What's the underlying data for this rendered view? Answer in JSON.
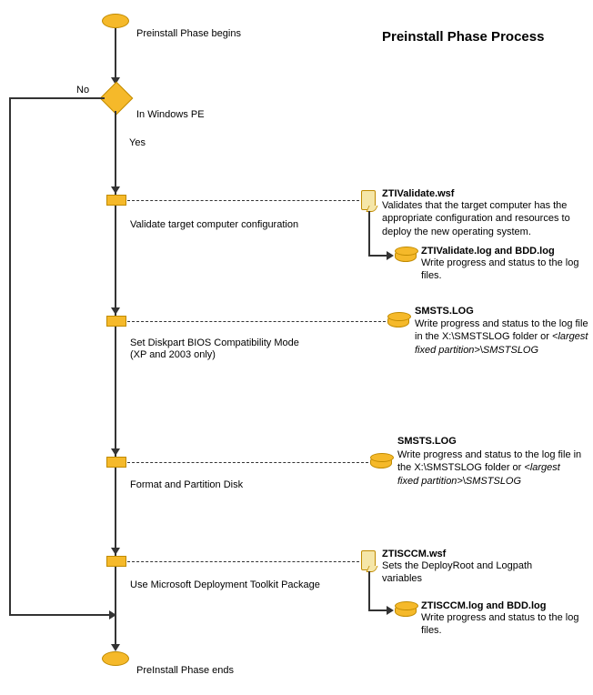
{
  "title": "Preinstall Phase Process",
  "start": "Preinstall Phase begins",
  "decision": {
    "label": "In Windows PE",
    "yes": "Yes",
    "no": "No"
  },
  "steps": [
    {
      "proc_label": "Validate target computer configuration",
      "right": [
        {
          "kind": "scroll",
          "title": "ZTIValidate.wsf",
          "text": "Validates that the target computer has the appropriate configuration and resources to deploy the new operating system."
        },
        {
          "kind": "db",
          "title": "ZTIValidate.log and BDD.log",
          "text": "Write progress and status to the log files."
        }
      ]
    },
    {
      "proc_label": "Set Diskpart BIOS Compatibility Mode",
      "proc_sub": "(XP and 2003 only)",
      "right": [
        {
          "kind": "db",
          "title": "SMSTS.LOG",
          "text_html": "Write progress and status to the log file in the X:\\SMSTSLOG folder or <i>&lt;largest fixed partition&gt;</i>\\<i>SMSTSLOG</i>"
        }
      ]
    },
    {
      "proc_label": "Format and Partition Disk",
      "right": [
        {
          "kind": "db",
          "title": "SMSTS.LOG",
          "text_html": "Write progress and status to the log file in the X:\\SMSTSLOG folder or <i>&lt;largest fixed partition&gt;</i>\\<i>SMSTSLOG</i>"
        }
      ]
    },
    {
      "proc_label": "Use Microsoft Deployment Toolkit Package",
      "right": [
        {
          "kind": "scroll",
          "title": "ZTISCCM.wsf",
          "text": "Sets the DeployRoot and Logpath variables"
        },
        {
          "kind": "db",
          "title": "ZTISCCM.log and BDD.log",
          "text": "Write progress and status to the log files."
        }
      ]
    }
  ],
  "end": "PreInstall Phase ends"
}
